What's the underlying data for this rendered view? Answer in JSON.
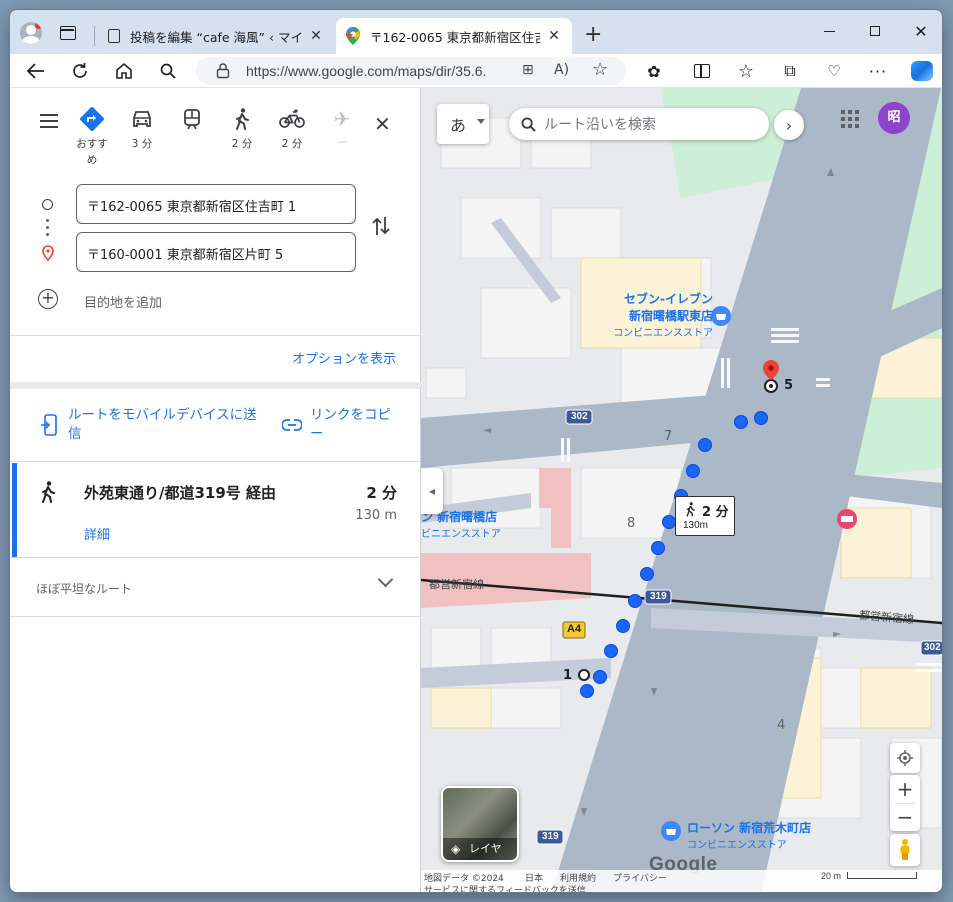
{
  "tabs": [
    {
      "title": "投稿を編集 “cafe 海風” ‹ マイブログ"
    },
    {
      "title": "〒162-0065 東京都新宿区住吉町"
    }
  ],
  "browser": {
    "url": "https://www.google.com/maps/dir/35.6..."
  },
  "travel_modes": [
    {
      "label": "おすすめ",
      "icon": "directions-icon"
    },
    {
      "label": "3 分",
      "icon": "car-icon"
    },
    {
      "label": "",
      "icon": "train-icon"
    },
    {
      "label": "2 分",
      "icon": "walk-icon"
    },
    {
      "label": "2 分",
      "icon": "bicycle-icon"
    },
    {
      "label": "—",
      "icon": "plane-icon"
    }
  ],
  "route": {
    "origin": "〒162-0065 東京都新宿区住吉町 1",
    "destination": "〒160-0001 東京都新宿区片町 5",
    "add_destination": "目的地を追加",
    "options": "オプションを表示",
    "send_mobile": "ルートをモバイルデバイスに送信",
    "copy_link": "リンクをコピー",
    "summary_title": "外苑東通り/都道319号 経由",
    "duration": "2 分",
    "distance": "130 m",
    "details": "詳細",
    "elevation": "ほぼ平坦なルート"
  },
  "map": {
    "ime_label": "あ",
    "search_placeholder": "ルート沿いを検索",
    "avatar_letter": "昭",
    "callout_time": "2 分",
    "callout_dist": "130m",
    "start_marker": "1",
    "end_marker": "5",
    "block_7": "7",
    "block_8": "8",
    "block_4": "4",
    "poi_711_name": "セブン-イレブン",
    "poi_711_name2": "新宿曙橋駅東店",
    "poi_711_type": "コンビニエンスストア",
    "poi_left_name": "ン 新宿曙橋店",
    "poi_left_type": "ビニエンスストア",
    "poi_lawson_name": "ローソン 新宿荒木町店",
    "poi_lawson_type": "コンビニエンスストア",
    "line_label_left": "都営新宿線",
    "line_label_right": "都営新宿線",
    "road_302": "302",
    "road_302b": "302",
    "road_319": "319",
    "road_319b": "319",
    "exit_a4": "A4",
    "layers": "レイヤ",
    "google": "Google",
    "footer": {
      "data": "地図データ ©2024",
      "japan": "日本",
      "terms": "利用規約",
      "privacy": "プライバシー",
      "feedback": "サービスに関するフィードバックを送信",
      "scale": "20 m"
    }
  }
}
